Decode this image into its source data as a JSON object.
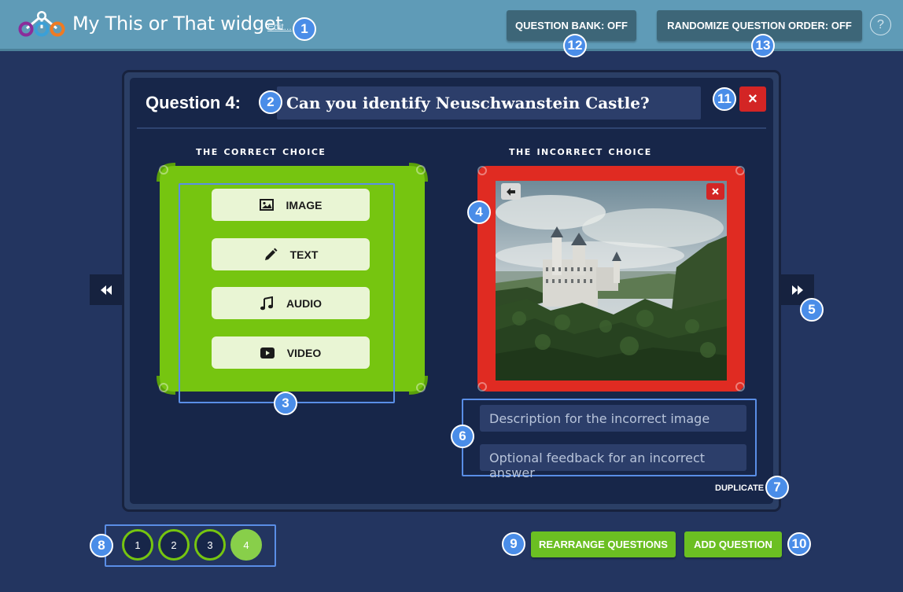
{
  "header": {
    "title": "My This or That widget",
    "edit_label": "Edit...",
    "question_bank_label": "QUESTION BANK: OFF",
    "randomize_label": "RANDOMIZE QUESTION ORDER: OFF",
    "help_label": "?"
  },
  "question": {
    "label": "Question 4:",
    "text": "Can you identify Neuschwanstein Castle?",
    "delete_icon": "×"
  },
  "correct": {
    "title": "The correct choice",
    "options": [
      {
        "label": "IMAGE",
        "icon": "image-icon"
      },
      {
        "label": "TEXT",
        "icon": "pencil-icon"
      },
      {
        "label": "AUDIO",
        "icon": "music-icon"
      },
      {
        "label": "VIDEO",
        "icon": "video-icon"
      }
    ]
  },
  "incorrect": {
    "title": "The incorrect choice",
    "description_placeholder": "Description for the incorrect image",
    "feedback_placeholder": "Optional feedback for an incorrect answer",
    "duplicate_label": "DUPLICATE"
  },
  "pager": {
    "pages": [
      "1",
      "2",
      "3",
      "4"
    ],
    "active": "4"
  },
  "actions": {
    "rearrange_label": "REARRANGE QUESTIONS",
    "add_label": "ADD QUESTION"
  },
  "badges": [
    "1",
    "2",
    "3",
    "4",
    "5",
    "6",
    "7",
    "8",
    "9",
    "10",
    "11",
    "12",
    "13"
  ],
  "colors": {
    "background": "#233560",
    "header": "#5f9bb7",
    "correct_frame": "#76c510",
    "incorrect_frame": "#e02b22",
    "accent": "#4a8de8",
    "button_green": "#6bbf22"
  }
}
